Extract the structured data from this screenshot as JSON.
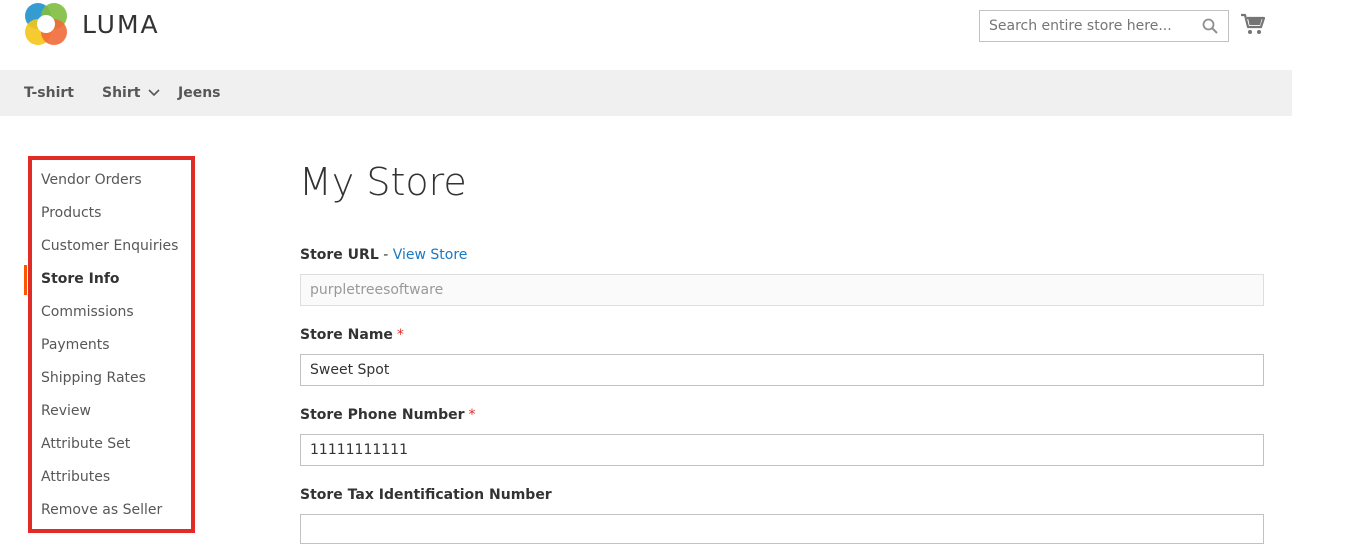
{
  "header": {
    "logo_text": "LUMA",
    "search": {
      "placeholder": "Search entire store here..."
    }
  },
  "nav": {
    "items": [
      {
        "label": "T-shirt"
      },
      {
        "label": "Shirt"
      },
      {
        "label": "Jeens"
      }
    ]
  },
  "sidebar": {
    "items": [
      {
        "label": "Vendor Orders"
      },
      {
        "label": "Products"
      },
      {
        "label": "Customer Enquiries"
      },
      {
        "label": "Store Info"
      },
      {
        "label": "Commissions"
      },
      {
        "label": "Payments"
      },
      {
        "label": "Shipping Rates"
      },
      {
        "label": "Review"
      },
      {
        "label": "Attribute Set"
      },
      {
        "label": "Attributes"
      },
      {
        "label": "Remove as Seller"
      }
    ],
    "active_index": 3
  },
  "main": {
    "title": "My Store",
    "store_url": {
      "label": "Store URL",
      "separator": " - ",
      "link": "View Store",
      "value": "purpletreesoftware"
    },
    "store_name": {
      "label": "Store Name",
      "required_mark": "*",
      "value": "Sweet Spot"
    },
    "store_phone": {
      "label": "Store Phone Number",
      "required_mark": "*",
      "value": "11111111111"
    },
    "store_tax": {
      "label": "Store Tax Identification Number",
      "value": ""
    }
  },
  "colors": {
    "accent": "#ff5501",
    "highlight_box": "#e02b27",
    "link": "#1979c3",
    "nav_bg": "#f0f0f0"
  }
}
